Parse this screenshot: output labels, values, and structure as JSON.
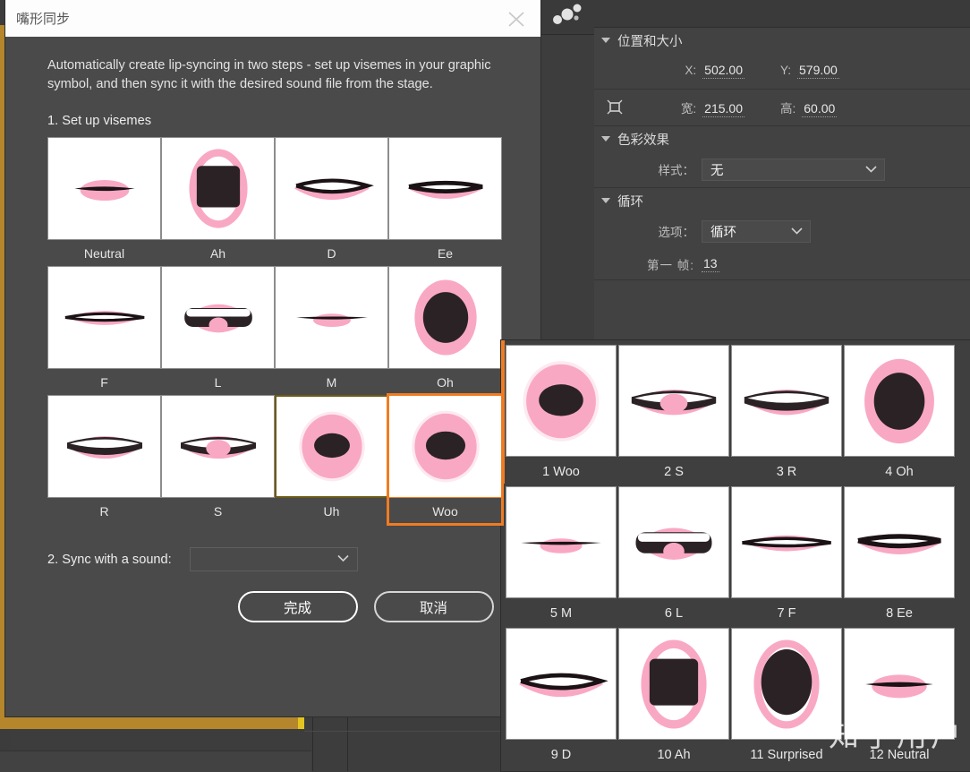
{
  "dialog": {
    "title": "嘴形同步",
    "close_icon": "close-icon",
    "description": "Automatically create lip-syncing in two steps - set up visemes in your graphic symbol, and then sync it with the desired sound file from the stage.",
    "step1_label": "1. Set up visemes",
    "step2_label": "2. Sync with a sound:",
    "sound_select_value": "",
    "done_label": "完成",
    "cancel_label": "取消",
    "selected_viseme": "Woo",
    "visemes": [
      {
        "label": "Neutral",
        "shape": "neutral",
        "state": "normal"
      },
      {
        "label": "Ah",
        "shape": "ah",
        "state": "normal"
      },
      {
        "label": "D",
        "shape": "d",
        "state": "normal"
      },
      {
        "label": "Ee",
        "shape": "ee",
        "state": "normal"
      },
      {
        "label": "F",
        "shape": "f",
        "state": "normal"
      },
      {
        "label": "L",
        "shape": "l",
        "state": "normal"
      },
      {
        "label": "M",
        "shape": "m",
        "state": "normal"
      },
      {
        "label": "Oh",
        "shape": "oh",
        "state": "normal"
      },
      {
        "label": "R",
        "shape": "r",
        "state": "normal"
      },
      {
        "label": "S",
        "shape": "s",
        "state": "normal"
      },
      {
        "label": "Uh",
        "shape": "uh",
        "state": "hover"
      },
      {
        "label": "Woo",
        "shape": "woo",
        "state": "selected"
      }
    ]
  },
  "properties": {
    "position_section": {
      "title": "位置和大小",
      "x_label": "X:",
      "x_value": "502.00",
      "y_label": "Y:",
      "y_value": "579.00",
      "width_label": "宽:",
      "width_value": "215.00",
      "height_label": "高:",
      "height_value": "60.00",
      "lock_icon": "link-constrain-icon"
    },
    "color_section": {
      "title": "色彩效果",
      "style_label": "样式：",
      "style_value": "无"
    },
    "loop_section": {
      "title": "循环",
      "option_label": "选项：",
      "option_value": "循环",
      "first_frame_label": "第一 帧:",
      "first_frame_value": "13"
    }
  },
  "viseme_panel": {
    "items": [
      {
        "label": "1 Woo",
        "shape": "woo"
      },
      {
        "label": "2 S",
        "shape": "s"
      },
      {
        "label": "3 R",
        "shape": "r"
      },
      {
        "label": "4 Oh",
        "shape": "oh"
      },
      {
        "label": "5 M",
        "shape": "m"
      },
      {
        "label": "6 L",
        "shape": "l"
      },
      {
        "label": "7 F",
        "shape": "f"
      },
      {
        "label": "8 Ee",
        "shape": "ee"
      },
      {
        "label": "9 D",
        "shape": "d"
      },
      {
        "label": "10 Ah",
        "shape": "ah"
      },
      {
        "label": "11 Surprised",
        "shape": "surprised"
      },
      {
        "label": "12 Neutral",
        "shape": "neutral"
      }
    ]
  },
  "watermark": "知乎用户",
  "colors": {
    "lip_pink": "#f9a8c4",
    "mouth_dark": "#2b2226",
    "selection_orange": "#f07c22",
    "hover_olive": "#6d5a16",
    "panel_bg": "#424242",
    "dialog_bg": "#4a4a4a",
    "gold_strip": "#b5862b"
  },
  "toolbar": {
    "object_icon": "object-dots-icon"
  }
}
